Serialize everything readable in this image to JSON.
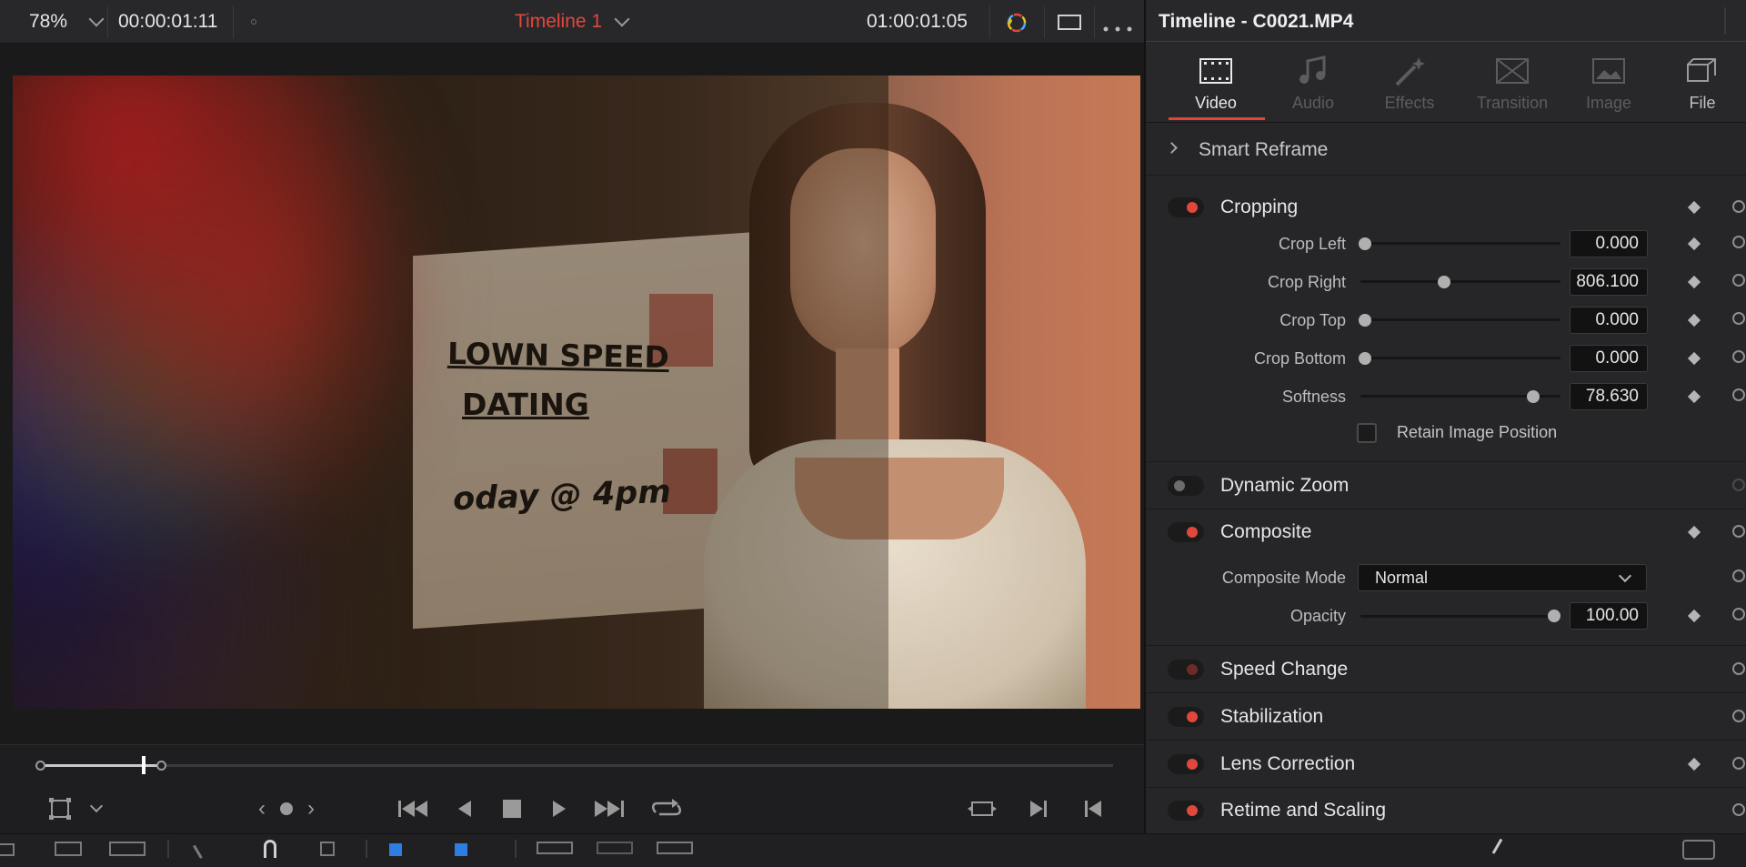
{
  "viewer": {
    "zoom": "78%",
    "timecode_left": "00:00:01:11",
    "timeline_name": "Timeline 1",
    "timecode_right": "01:00:01:05",
    "sign_lines": [
      "LOWN SPEED",
      "DATING",
      "oday @ 4pm"
    ],
    "playhead_position": 0.1,
    "colors": {
      "timeline_title": "#e2473d",
      "accent": "#e2473d"
    }
  },
  "transport": {
    "icons": [
      "crop-tool-icon",
      "chevron-down-icon",
      "prev-clip-icon",
      "clip-dot-icon",
      "next-clip-icon",
      "skip-to-start-icon",
      "reverse-play-icon",
      "stop-icon",
      "play-icon",
      "skip-to-end-icon",
      "loop-icon",
      "match-frame-icon",
      "next-edit-icon",
      "prev-edit-icon"
    ]
  },
  "inspector": {
    "title": "Timeline - C0021.MP4",
    "tabs": [
      {
        "label": "Video",
        "icon": "film-icon",
        "active": true
      },
      {
        "label": "Audio",
        "icon": "music-note-icon",
        "active": false
      },
      {
        "label": "Effects",
        "icon": "magic-wand-icon",
        "active": false
      },
      {
        "label": "Transition",
        "icon": "transition-icon",
        "active": false
      },
      {
        "label": "Image",
        "icon": "image-icon",
        "active": false
      },
      {
        "label": "File",
        "icon": "file-icon",
        "active": false
      }
    ],
    "smart_reframe": {
      "title": "Smart Reframe"
    },
    "cropping": {
      "title": "Cropping",
      "enabled": true,
      "params": [
        {
          "label": "Crop Left",
          "value": "0.000",
          "slider": 0.0
        },
        {
          "label": "Crop Right",
          "value": "806.100",
          "slider": 0.42
        },
        {
          "label": "Crop Top",
          "value": "0.000",
          "slider": 0.0
        },
        {
          "label": "Crop Bottom",
          "value": "0.000",
          "slider": 0.0
        },
        {
          "label": "Softness",
          "value": "78.630",
          "slider": 0.89
        }
      ],
      "retain_label": "Retain Image Position",
      "retain_checked": false
    },
    "dynamic_zoom": {
      "title": "Dynamic Zoom",
      "enabled": false
    },
    "composite": {
      "title": "Composite",
      "enabled": true,
      "mode_label": "Composite Mode",
      "mode_value": "Normal",
      "opacity_label": "Opacity",
      "opacity_value": "100.00",
      "opacity_slider": 1.0
    },
    "speed_change": {
      "title": "Speed Change",
      "enabled": true
    },
    "stabilization": {
      "title": "Stabilization",
      "enabled": true
    },
    "lens_correction": {
      "title": "Lens Correction",
      "enabled": true
    },
    "retime_scaling": {
      "title": "Retime and Scaling",
      "enabled": true
    }
  }
}
